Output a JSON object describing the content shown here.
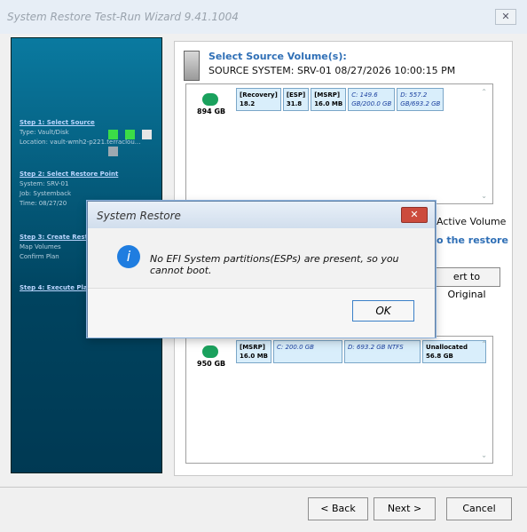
{
  "window": {
    "title": "System Restore Test-Run Wizard 9.41.1004",
    "close_label": "✕"
  },
  "sidebar": {
    "steps": [
      {
        "title": "Step 1: Select Source",
        "details": [
          "Type: Vault/Disk",
          "Location: vault-wmh2-p221.terraclou..."
        ]
      },
      {
        "title": "Step 2: Select Restore Point",
        "details": [
          "System: SRV-01",
          "Job: Systemback",
          "Time: 08/27/20"
        ]
      },
      {
        "title": "Step 3: Create Restor",
        "details": [
          "Map Volumes",
          "Confirm Plan"
        ]
      },
      {
        "title": "Step 4: Execute Plan",
        "details": []
      }
    ],
    "colors": [
      "#3bdc47",
      "#3bdc47",
      "#e6e6e6",
      "#9da9b1"
    ]
  },
  "main": {
    "heading": "Select Source Volume(s):",
    "source_system": "SOURCE SYSTEM:  SRV-01 08/27/2026 10:00:15 PM",
    "disk1_size": "894 GB",
    "disk1_parts": [
      {
        "label": "[Recovery]",
        "size": "18.2"
      },
      {
        "label": "[ESP]",
        "size": "31.8"
      },
      {
        "label": "[MSRP]",
        "size": "16.0 MB"
      },
      {
        "label": "C: 149.6",
        "size": "GB/200.0 GB"
      },
      {
        "label": "D: 557.2",
        "size": "GB/693.2 GB"
      }
    ],
    "active_volume": "Active Volume",
    "restore_link": "o the restore",
    "revert_label": "ert to Original",
    "disk2_size": "950 GB",
    "disk2_parts": [
      {
        "label": "[MSRP]",
        "size": "16.0 MB"
      },
      {
        "label": "C: 200.0 GB",
        "size": ""
      },
      {
        "label": "D: 693.2 GB NTFS",
        "size": ""
      },
      {
        "label": "Unallocated",
        "size": "56.8 GB"
      }
    ]
  },
  "dialog": {
    "title": "System Restore",
    "close_label": "✕",
    "message": "No EFI System partitions(ESPs) are present, so you cannot boot.",
    "ok": "OK"
  },
  "footer": {
    "back": "< Back",
    "next": "Next >",
    "cancel": "Cancel"
  }
}
